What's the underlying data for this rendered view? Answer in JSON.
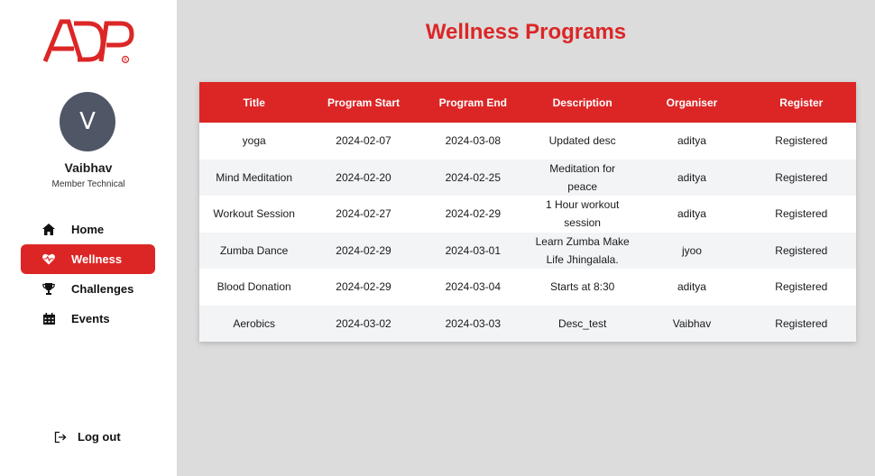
{
  "brand": {
    "logo_text": "ADP",
    "accent_color": "#dc2626"
  },
  "user": {
    "initial": "V",
    "name": "Vaibhav",
    "role": "Member Technical"
  },
  "nav": {
    "items": [
      {
        "label": "Home",
        "icon": "home-icon",
        "active": false
      },
      {
        "label": "Wellness",
        "icon": "heartbeat-icon",
        "active": true
      },
      {
        "label": "Challenges",
        "icon": "trophy-icon",
        "active": false
      },
      {
        "label": "Events",
        "icon": "calendar-icon",
        "active": false
      }
    ],
    "logout_label": "Log out"
  },
  "page": {
    "title": "Wellness Programs"
  },
  "table": {
    "columns": [
      "Title",
      "Program Start",
      "Program End",
      "Description",
      "Organiser",
      "Register"
    ],
    "rows": [
      [
        "yoga",
        "2024-02-07",
        "2024-03-08",
        "Updated desc",
        "aditya",
        "Registered"
      ],
      [
        "Mind Meditation",
        "2024-02-20",
        "2024-02-25",
        "Meditation for peace",
        "aditya",
        "Registered"
      ],
      [
        "Workout Session",
        "2024-02-27",
        "2024-02-29",
        "1 Hour workout session",
        "aditya",
        "Registered"
      ],
      [
        "Zumba Dance",
        "2024-02-29",
        "2024-03-01",
        "Learn Zumba Make Life Jhingalala.",
        "jyoo",
        "Registered"
      ],
      [
        "Blood Donation",
        "2024-02-29",
        "2024-03-04",
        "Starts at 8:30",
        "aditya",
        "Registered"
      ],
      [
        "Aerobics",
        "2024-03-02",
        "2024-03-03",
        "Desc_test",
        "Vaibhav",
        "Registered"
      ]
    ]
  }
}
